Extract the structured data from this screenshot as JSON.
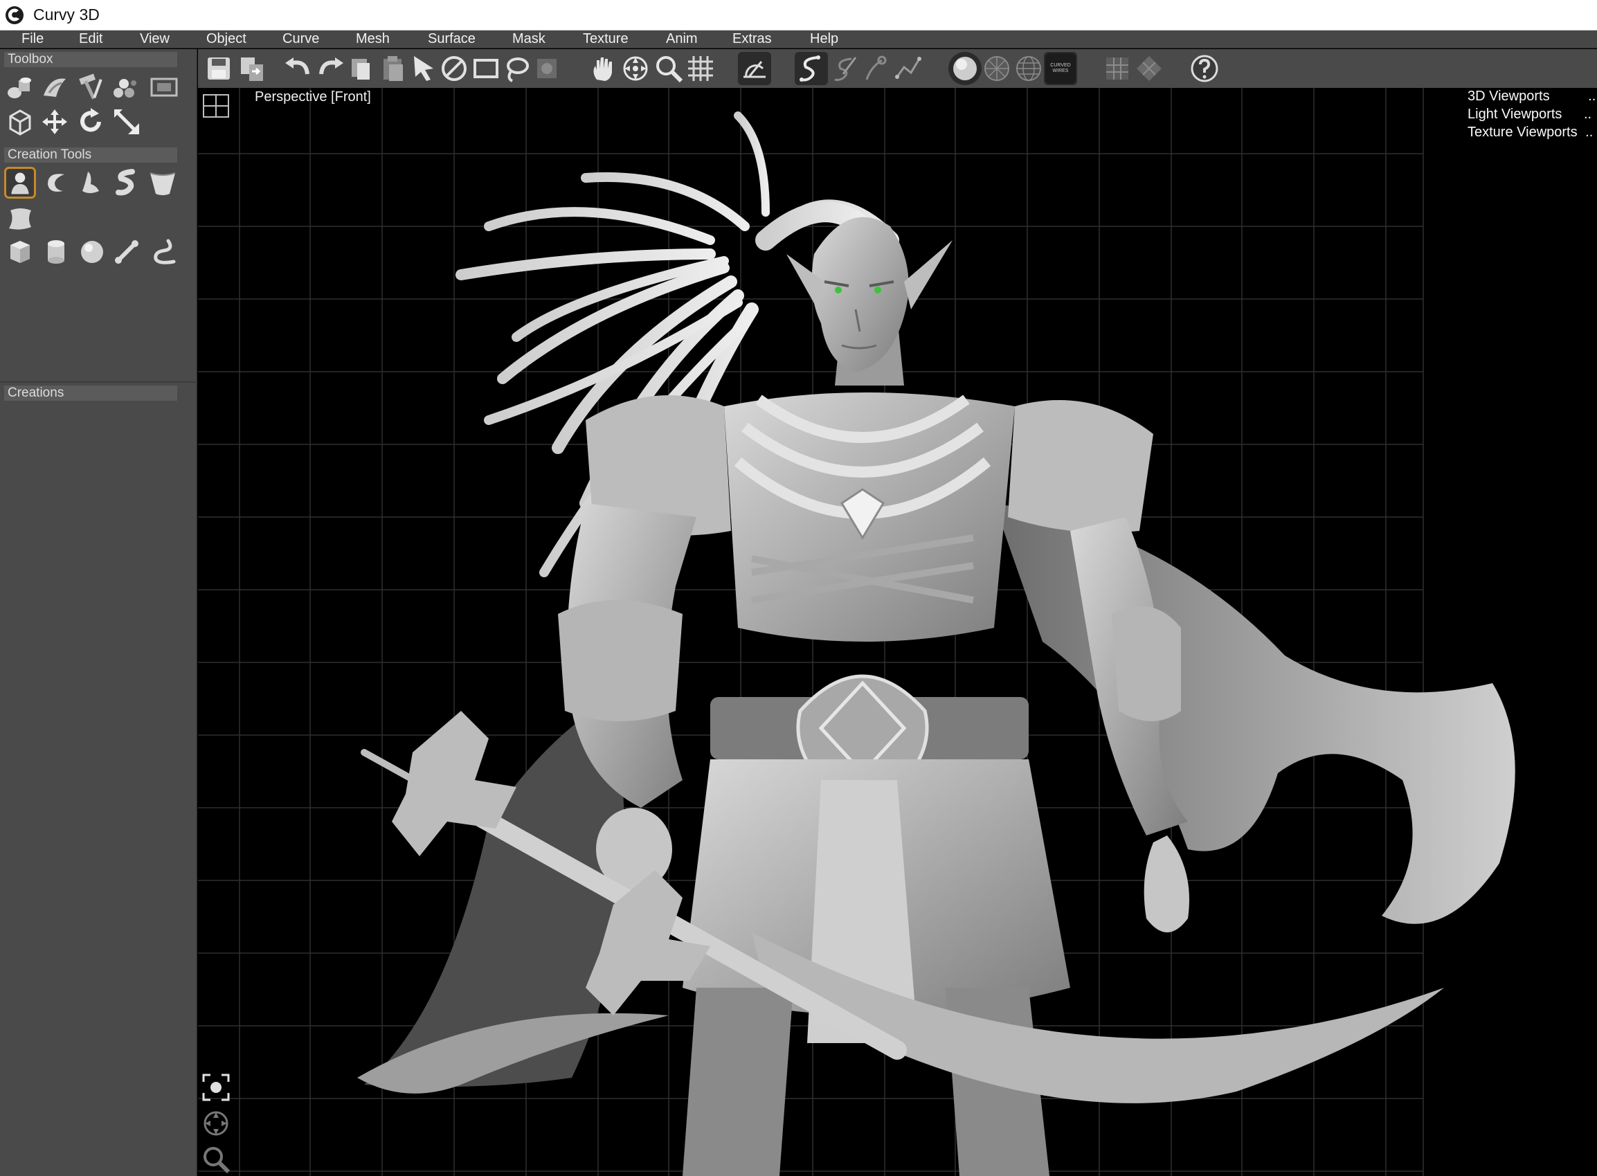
{
  "window": {
    "title": "Curvy 3D"
  },
  "menu": [
    "File",
    "Edit",
    "View",
    "Object",
    "Curve",
    "Mesh",
    "Surface",
    "Mask",
    "Texture",
    "Anim",
    "Extras",
    "Help"
  ],
  "left_panel": {
    "toolbox_title": "Toolbox",
    "creation_tools_title": "Creation Tools",
    "creations_title": "Creations"
  },
  "toolbar": {
    "view_mode_label": "CURVED WIRES"
  },
  "viewport": {
    "label": "Perspective [Front]",
    "menu": [
      "3D Viewports",
      "Light Viewports",
      "Texture Viewports"
    ],
    "menu_more": ".."
  },
  "colors": {
    "menu_bg": "#474747",
    "panel_bg": "#4a4a4a",
    "viewport_bg": "#000000",
    "active_tool_border": "#c88a26",
    "grid_line": "#3a3a3a",
    "eye_green": "#3ec23e"
  }
}
